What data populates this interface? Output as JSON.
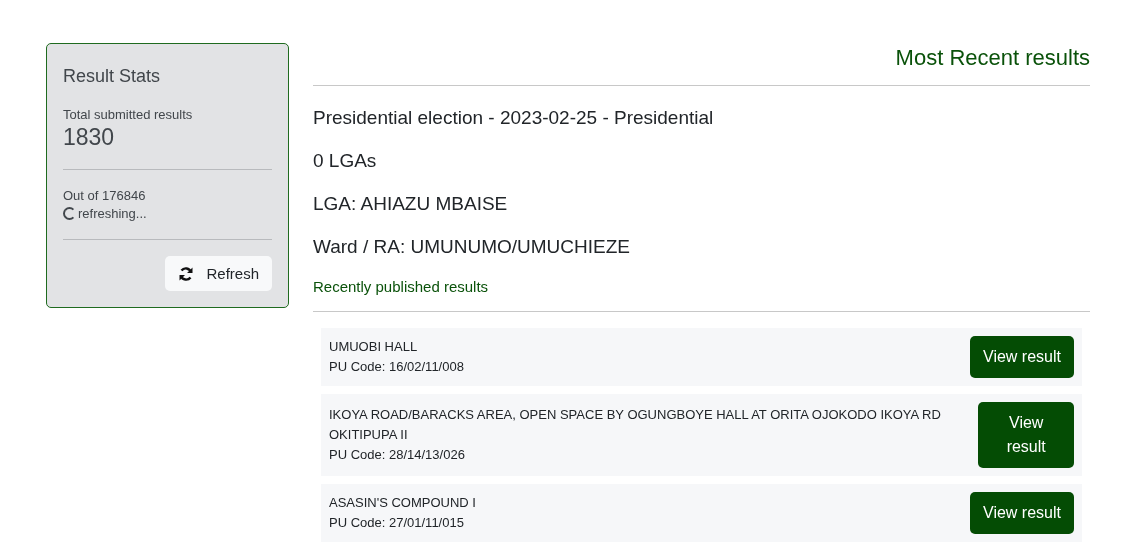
{
  "stats": {
    "title": "Result Stats",
    "total_label": "Total submitted results",
    "total_value": "1830",
    "out_of": "Out of 176846",
    "status": "refreshing...",
    "refreshing": true,
    "refresh_button": "Refresh"
  },
  "main": {
    "title": "Most Recent results",
    "election": "Presidential election - 2023-02-25 - Presidential",
    "lga_count": "0 LGAs",
    "lga": "LGA: AHIAZU MBAISE",
    "ward": "Ward / RA: UMUNUMO/UMUCHIEZE",
    "section_title": "Recently published results",
    "results": [
      {
        "name": "UMUOBI HALL",
        "code": "PU Code: 16/02/11/008",
        "button": "View result"
      },
      {
        "name": "IKOYA ROAD/BARACKS AREA, OPEN SPACE BY OGUNGBOYE HALL AT ORITA OJOKODO IKOYA RD OKITIPUPA II",
        "code": "PU Code: 28/14/13/026",
        "button": "View result"
      },
      {
        "name": "ASASIN'S COMPOUND I",
        "code": "PU Code: 27/01/11/015",
        "button": "View result"
      }
    ]
  }
}
